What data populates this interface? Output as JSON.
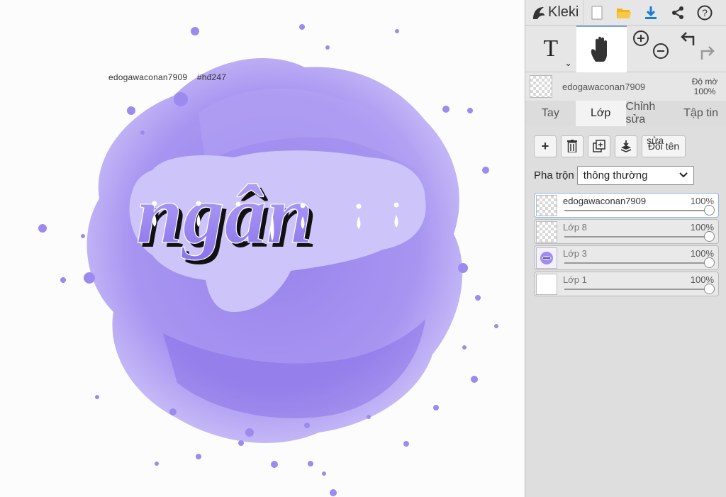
{
  "app": {
    "logo_text": "Kleki"
  },
  "canvas": {
    "watermark_user": "edogawaconan7909",
    "watermark_tag": "#hđ247",
    "artwork_text": "ngân",
    "colors": {
      "splash": "#9b86ee",
      "splash_light": "#b9a9f5",
      "cloud": "#cdc4fa",
      "letter_fill": "#9f8ef0",
      "letter_shadow": "#111111"
    }
  },
  "toolbar": {
    "top_icons": [
      "new-file-icon",
      "open-folder-icon",
      "download-icon",
      "share-icon",
      "help-icon"
    ],
    "tools": [
      "text-tool",
      "hand-tool",
      "zoom-in",
      "zoom-out",
      "undo",
      "redo"
    ],
    "text_tool_label": "T"
  },
  "active_layer": {
    "name": "edogawaconan7909",
    "opacity_label": "Độ mờ",
    "opacity_value": "100%"
  },
  "tabs": [
    {
      "label": "Tay",
      "active": false
    },
    {
      "label": "Lớp",
      "active": true
    },
    {
      "label": "Chỉnh sửa",
      "active": false
    },
    {
      "label": "Tập tin",
      "active": false
    }
  ],
  "layer_actions": {
    "add": "+",
    "rename_label": "Đổi tên",
    "rename_overlay": "sửa"
  },
  "blend": {
    "label": "Pha trộn",
    "value": "thông thường"
  },
  "layers": [
    {
      "name": "edogawaconan7909",
      "opacity": "100%",
      "level": 1.0,
      "selected": true
    },
    {
      "name": "Lớp 8",
      "opacity": "100%",
      "level": 1.0,
      "selected": false
    },
    {
      "name": "Lớp 3",
      "opacity": "100%",
      "level": 1.0,
      "selected": false
    },
    {
      "name": "Lớp 1",
      "opacity": "100%",
      "level": 1.0,
      "selected": false
    }
  ]
}
